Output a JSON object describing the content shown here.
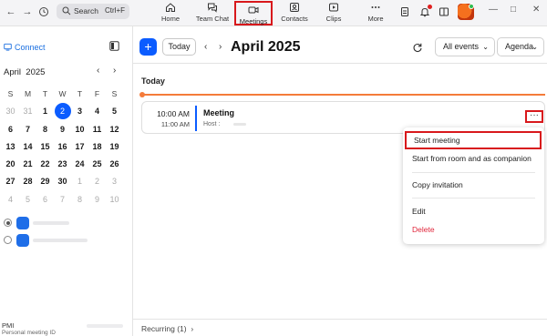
{
  "topbar": {
    "search_placeholder": "Search",
    "search_shortcut": "Ctrl+F",
    "tabs": [
      {
        "label": "Home",
        "icon": "home-icon"
      },
      {
        "label": "Team Chat",
        "icon": "chat-icon"
      },
      {
        "label": "Meetings",
        "icon": "video-camera-icon",
        "active": true
      },
      {
        "label": "Contacts",
        "icon": "contacts-icon"
      },
      {
        "label": "Clips",
        "icon": "clips-icon"
      },
      {
        "label": "More",
        "icon": "more-dots-icon"
      }
    ]
  },
  "sidebar": {
    "connect_label": "Connect",
    "month": "April",
    "year": "2025",
    "weekdays": [
      "S",
      "M",
      "T",
      "W",
      "T",
      "F",
      "S"
    ],
    "weeks": [
      [
        "30",
        "31",
        "1",
        "2",
        "3",
        "4",
        "5"
      ],
      [
        "6",
        "7",
        "8",
        "9",
        "10",
        "11",
        "12"
      ],
      [
        "13",
        "14",
        "15",
        "16",
        "17",
        "18",
        "19"
      ],
      [
        "20",
        "21",
        "22",
        "23",
        "24",
        "25",
        "26"
      ],
      [
        "27",
        "28",
        "29",
        "30",
        "1",
        "2",
        "3"
      ],
      [
        "4",
        "5",
        "6",
        "7",
        "8",
        "9",
        "10"
      ]
    ],
    "pmi_label": "PMI",
    "pmi_sub": "Personal meeting ID"
  },
  "main": {
    "today_button": "Today",
    "title": "April 2025",
    "filter": "All events",
    "view": "Agenda",
    "section_label": "Today",
    "event": {
      "start": "10:00 AM",
      "end": "11:00 AM",
      "title": "Meeting",
      "host_label": "Host :"
    },
    "more_button": "···",
    "recurring_label": "Recurring (1)"
  },
  "menu": {
    "start_meeting": "Start meeting",
    "start_from_room": "Start from room and as companion",
    "copy_invitation": "Copy invitation",
    "edit": "Edit",
    "delete": "Delete"
  },
  "colors": {
    "accent": "#0b5cff",
    "highlight_box": "#d8181c",
    "now_line": "#f47b3a",
    "danger": "#e0263b"
  }
}
